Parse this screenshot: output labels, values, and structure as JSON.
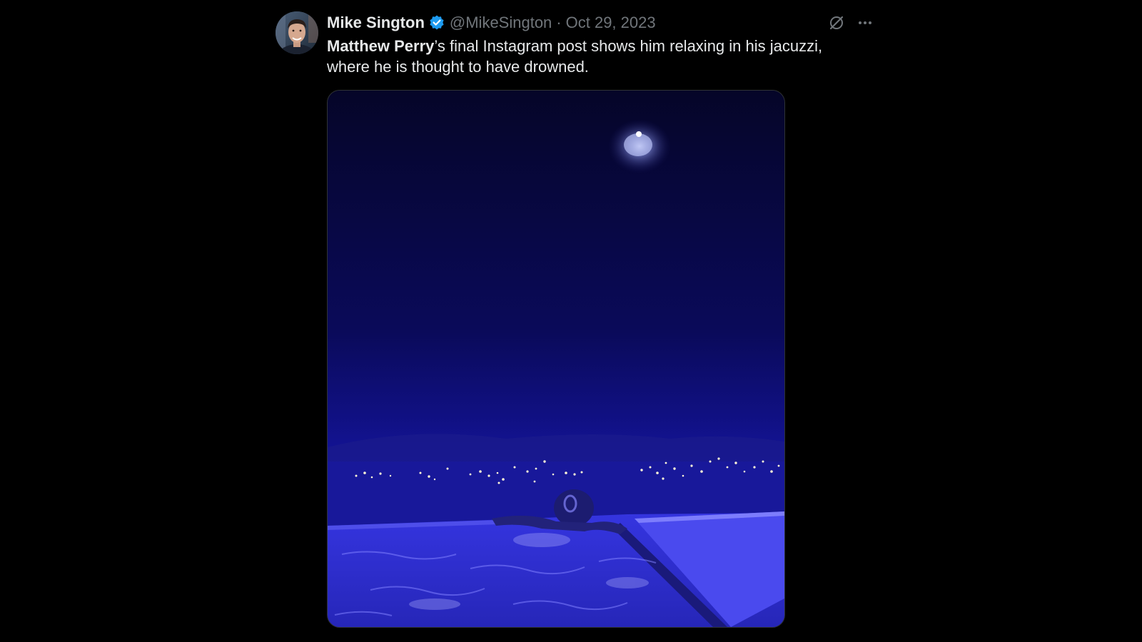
{
  "tweet": {
    "author": {
      "display_name": "Mike Sington",
      "handle": "@MikeSington",
      "verified": true
    },
    "separator": "·",
    "date": "Oct 29, 2023",
    "text": {
      "mention": "Matthew Perry",
      "rest": "’s final Instagram post shows him relaxing in his jacuzzi, where he is thought to have drowned."
    },
    "icons": {
      "avatar": "profile-photo",
      "verified": "verified-badge-icon",
      "grok": "grok-icon",
      "more": "more-icon"
    },
    "media": {
      "kind": "photo",
      "subject": "night-sky-moon-city-lights-jacuzzi"
    }
  },
  "colors": {
    "background": "#000000",
    "primary_text": "#e7e9ea",
    "secondary_text": "#71767b",
    "verified_blue": "#1d9bf0",
    "media_tint": "#2a2ad6"
  }
}
